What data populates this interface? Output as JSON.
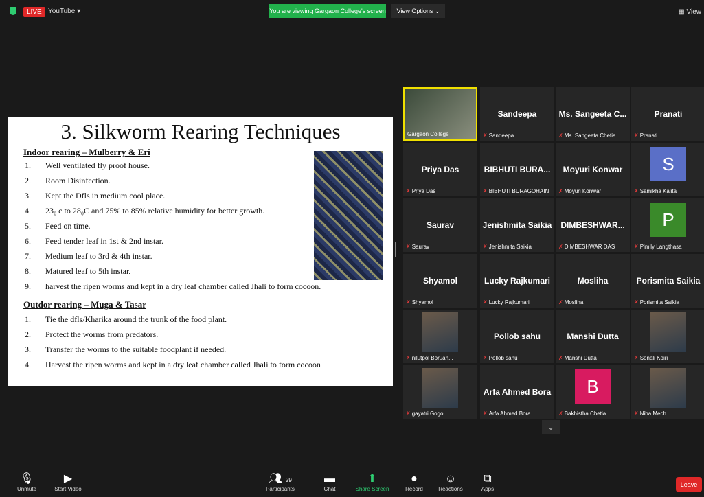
{
  "topbar": {
    "live": "LIVE",
    "stream": "YouTube ▾",
    "banner": "You are viewing Gargaon College's screen",
    "view_options": "View Options  ⌄",
    "view": "View"
  },
  "slide": {
    "title": "3. Silkworm Rearing Techniques",
    "indoor_heading": "Indoor rearing – Mulberry & Eri",
    "indoor": [
      {
        "n": "1.",
        "t": "Well ventilated fly proof house."
      },
      {
        "n": "2.",
        "t": "Room Disinfection."
      },
      {
        "n": "3.",
        "t": "Kept the Dfls in medium cool place."
      },
      {
        "n": "4.",
        "t": "23₀ c to 28₀C and 75% to 85% relative humidity  for better growth."
      },
      {
        "n": "5.",
        "t": "Feed on time."
      },
      {
        "n": "6.",
        "t": "Feed tender leaf in 1st & 2nd instar."
      },
      {
        "n": "7.",
        "t": "Medium leaf to 3rd & 4th instar."
      },
      {
        "n": "8.",
        "t": "Matured leaf to 5th instar."
      },
      {
        "n": "9.",
        "t": "harvest the ripen worms and kept in a dry leaf chamber called Jhali to form cocoon."
      }
    ],
    "outdoor_heading": "Outdor rearing – Muga & Tasar",
    "outdoor": [
      {
        "n": "1.",
        "t": "Tie the dfls/Kharika around the trunk of the food plant."
      },
      {
        "n": "2.",
        "t": "Protect the worms from predators."
      },
      {
        "n": "3.",
        "t": "Transfer the worms to the suitable foodplant if needed."
      },
      {
        "n": "4.",
        "t": "Harvest the ripen worms and kept in a dry leaf chamber called Jhali to form cocoon"
      }
    ]
  },
  "participants": [
    {
      "label": "Gargaon College",
      "kind": "photo"
    },
    {
      "name": "Sandeepa",
      "label": "Sandeepa"
    },
    {
      "name": "Ms. Sangeeta C...",
      "label": "Ms. Sangeeta Chetia"
    },
    {
      "name": "Pranati",
      "label": "Pranati"
    },
    {
      "name": "Priya Das",
      "label": "Priya Das"
    },
    {
      "name": "BIBHUTI BURA...",
      "label": "BIBHUTI BURAGOHAIN"
    },
    {
      "name": "Moyuri Konwar",
      "label": "Moyuri Konwar"
    },
    {
      "avatar": "S",
      "color": "#5a6fc7",
      "label": "Samikha Kalita"
    },
    {
      "name": "Saurav",
      "label": "Saurav"
    },
    {
      "name": "Jenishmita Saikia",
      "label": "Jenishmita Saikia"
    },
    {
      "name": "DIMBESHWAR...",
      "label": "DIMBESHWAR DAS"
    },
    {
      "avatar": "P",
      "color": "#3a8a2a",
      "label": "Pimily Langthasa"
    },
    {
      "name": "Shyamol",
      "label": "Shyamol"
    },
    {
      "name": "Lucky Rajkumari",
      "label": "Lucky Rajkumari"
    },
    {
      "name": "Mosliha",
      "label": "Mosliha"
    },
    {
      "name": "Porismita Saikia",
      "label": "Porismita Saikia"
    },
    {
      "label": "nilutpol Boruah...",
      "kind": "photo"
    },
    {
      "name": "Pollob sahu",
      "label": "Pollob sahu"
    },
    {
      "name": "Manshi Dutta",
      "label": "Manshi Dutta"
    },
    {
      "label": "Sonali Koiri",
      "kind": "photo"
    },
    {
      "label": "gayatri Gogoi",
      "kind": "photo"
    },
    {
      "name": "Arfa Ahmed Bora",
      "label": "Arfa Ahmed Bora"
    },
    {
      "avatar": "B",
      "color": "#d81b60",
      "label": "Bakhistha Chetia"
    },
    {
      "label": "Niha Mech",
      "kind": "photo"
    }
  ],
  "controls": {
    "unmute": "Unmute",
    "start_video": "Start Video",
    "participants": "Participants",
    "participant_count": "29",
    "chat": "Chat",
    "share": "Share Screen",
    "record": "Record",
    "reactions": "Reactions",
    "apps": "Apps",
    "leave": "Leave"
  },
  "colors": {
    "share": "#2ecc71",
    "leave": "#e02828",
    "banner": "#22b14c"
  }
}
